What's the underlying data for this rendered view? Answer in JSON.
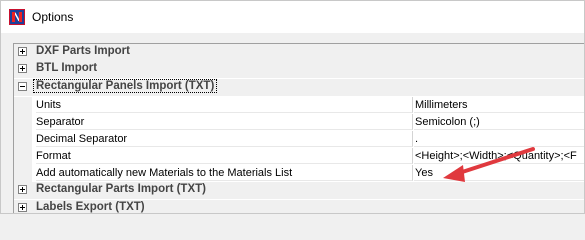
{
  "window": {
    "title": "Options",
    "app_icon": "app-logo-icon"
  },
  "grid": {
    "categories_top": [
      {
        "label": "DXF Parts Import",
        "expanded": false
      },
      {
        "label": "BTL Import",
        "expanded": false
      }
    ],
    "open_category": {
      "label": "Rectangular Panels Import (TXT)",
      "expanded": true
    },
    "properties": [
      {
        "name": "Units",
        "value": "Millimeters"
      },
      {
        "name": "Separator",
        "value": "Semicolon (;)"
      },
      {
        "name": "Decimal Separator",
        "value": "."
      },
      {
        "name": "Format",
        "value": "<Height>;<Width>;<Quantity>;<F"
      },
      {
        "name": "Add automatically new Materials to the Materials List",
        "value": "Yes"
      }
    ],
    "categories_bottom": [
      {
        "label": "Rectangular Parts Import (TXT)",
        "expanded": false
      },
      {
        "label": "Labels Export (TXT)",
        "expanded": false
      }
    ]
  },
  "annotation": {
    "arrow_color": "#e0393e"
  }
}
